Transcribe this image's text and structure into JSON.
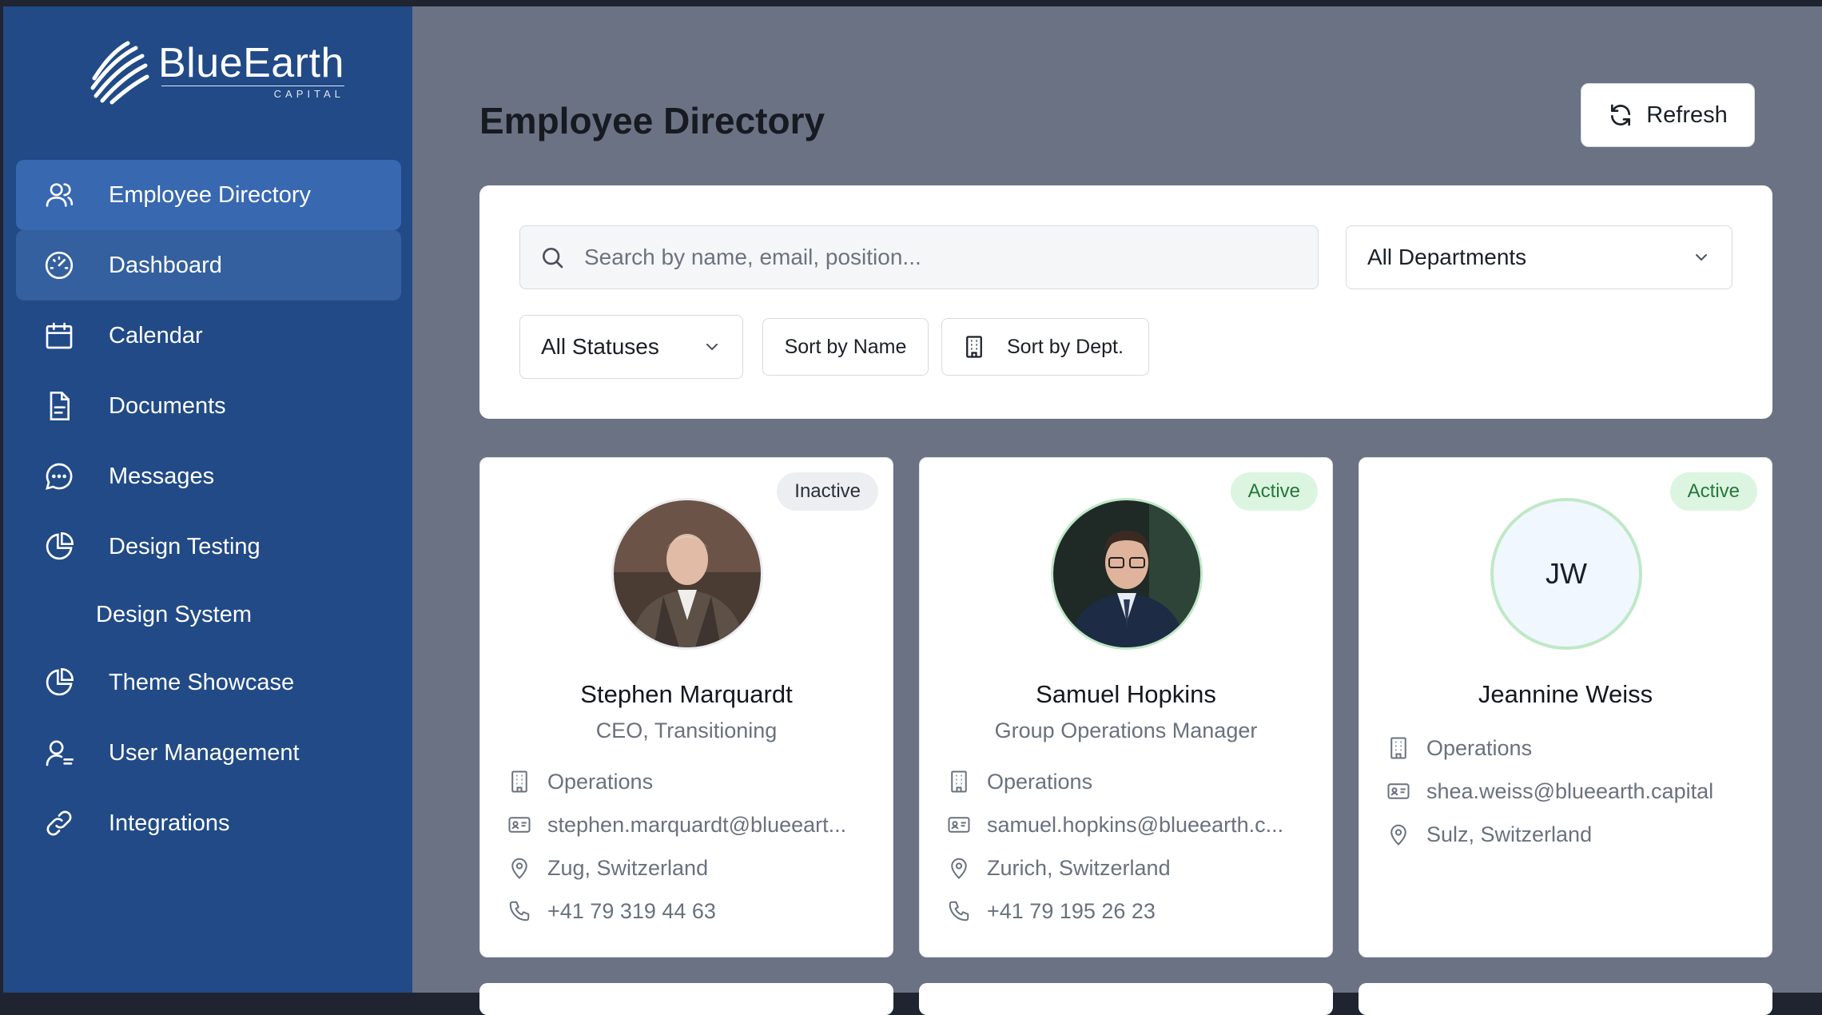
{
  "brand": {
    "name": "BlueEarth",
    "sub": "CAPITAL"
  },
  "sidebar": {
    "items": [
      {
        "label": "Employee Directory",
        "icon": "users-icon"
      },
      {
        "label": "Dashboard",
        "icon": "gauge-icon"
      },
      {
        "label": "Calendar",
        "icon": "calendar-icon"
      },
      {
        "label": "Documents",
        "icon": "document-icon"
      },
      {
        "label": "Messages",
        "icon": "message-icon"
      },
      {
        "label": "Design Testing",
        "icon": "pie-chart-icon"
      },
      {
        "label": "Design System",
        "icon": ""
      },
      {
        "label": "Theme Showcase",
        "icon": "pie-chart-icon"
      },
      {
        "label": "User Management",
        "icon": "user-manage-icon"
      },
      {
        "label": "Integrations",
        "icon": "link-icon"
      }
    ]
  },
  "header": {
    "title": "Employee Directory",
    "refresh_label": "Refresh"
  },
  "filters": {
    "search_placeholder": "Search by name, email, position...",
    "department": "All Departments",
    "status": "All Statuses",
    "sort_name_label": "Sort by Name",
    "sort_dept_label": "Sort by Dept."
  },
  "employees": [
    {
      "status": "Inactive",
      "name": "Stephen Marquardt",
      "title": "CEO, Transitioning",
      "department": "Operations",
      "email": "stephen.marquardt@blueeart...",
      "location": "Zug, Switzerland",
      "phone": "+41 79 319 44 63"
    },
    {
      "status": "Active",
      "name": "Samuel Hopkins",
      "title": "Group Operations Manager",
      "department": "Operations",
      "email": "samuel.hopkins@blueearth.c...",
      "location": "Zurich, Switzerland",
      "phone": "+41 79 195 26 23"
    },
    {
      "status": "Active",
      "name": "Jeannine Weiss",
      "initials": "JW",
      "department": "Operations",
      "email": "shea.weiss@blueearth.capital",
      "location": "Sulz, Switzerland"
    }
  ],
  "colors": {
    "sidebar": "#214a87",
    "active_nav": "#3868b0",
    "main_bg": "#6b7283",
    "active_badge": "#dcf5e0"
  }
}
